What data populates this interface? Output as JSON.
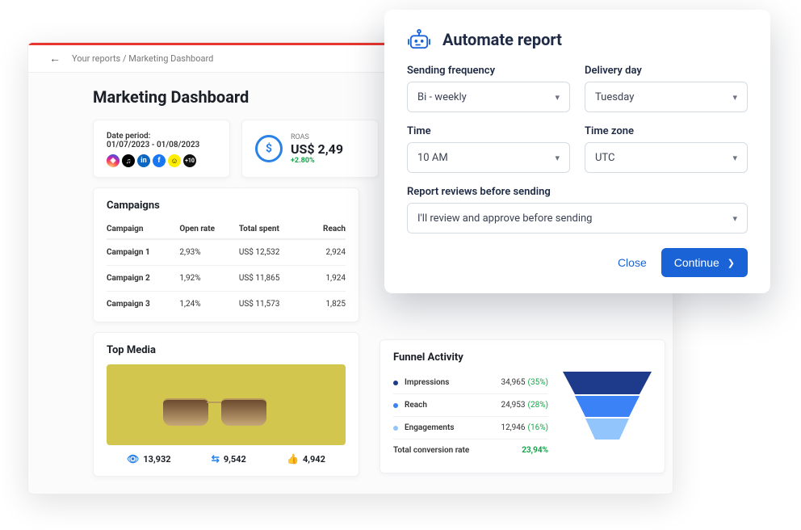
{
  "breadcrumb": "Your reports / Marketing Dashboard",
  "page_title": "Marketing Dashboard",
  "date": {
    "label": "Date period:",
    "range": "01/07/2023 - 01/08/2023",
    "more_badge": "+10"
  },
  "roas": {
    "label": "ROAS",
    "value": "US$ 2,49",
    "delta": "+2.80%"
  },
  "campaigns": {
    "title": "Campaigns",
    "headers": {
      "name": "Campaign",
      "open": "Open rate",
      "spent": "Total spent",
      "reach": "Reach"
    },
    "rows": [
      {
        "name": "Campaign 1",
        "open": "2,93%",
        "spent": "US$ 12,532",
        "reach": "2,924"
      },
      {
        "name": "Campaign 2",
        "open": "1,92%",
        "spent": "US$ 11,865",
        "reach": "1,924"
      },
      {
        "name": "Campaign 3",
        "open": "1,24%",
        "spent": "US$ 11,573",
        "reach": "1,825"
      }
    ]
  },
  "topmedia": {
    "title": "Top Media",
    "views": "13,932",
    "shares": "9,542",
    "likes": "4,942"
  },
  "funnel": {
    "title": "Funnel Activity",
    "rows": [
      {
        "label": "Impressions",
        "value": "34,965",
        "pct": "(35%)"
      },
      {
        "label": "Reach",
        "value": "24,953",
        "pct": "(28%)"
      },
      {
        "label": "Engagements",
        "value": "12,946",
        "pct": "(16%)"
      }
    ],
    "total": {
      "label": "Total conversion rate",
      "value": "23,94%"
    }
  },
  "modal": {
    "title": "Automate report",
    "fields": {
      "frequency": {
        "label": "Sending frequency",
        "value": "Bi - weekly"
      },
      "day": {
        "label": "Delivery day",
        "value": "Tuesday"
      },
      "time": {
        "label": "Time",
        "value": "10 AM"
      },
      "tz": {
        "label": "Time zone",
        "value": "UTC"
      },
      "review": {
        "label": "Report reviews before sending",
        "value": "I'll review and approve before sending"
      }
    },
    "close": "Close",
    "continue": "Continue"
  },
  "chart_data": {
    "type": "funnel",
    "title": "Funnel Activity",
    "stages": [
      {
        "name": "Impressions",
        "value": 34965,
        "pct": 35,
        "color": "#1e3a8a"
      },
      {
        "name": "Reach",
        "value": 24953,
        "pct": 28,
        "color": "#3b82f6"
      },
      {
        "name": "Engagements",
        "value": 12946,
        "pct": 16,
        "color": "#93c5fd"
      }
    ],
    "total_conversion_rate": "23,94%"
  }
}
